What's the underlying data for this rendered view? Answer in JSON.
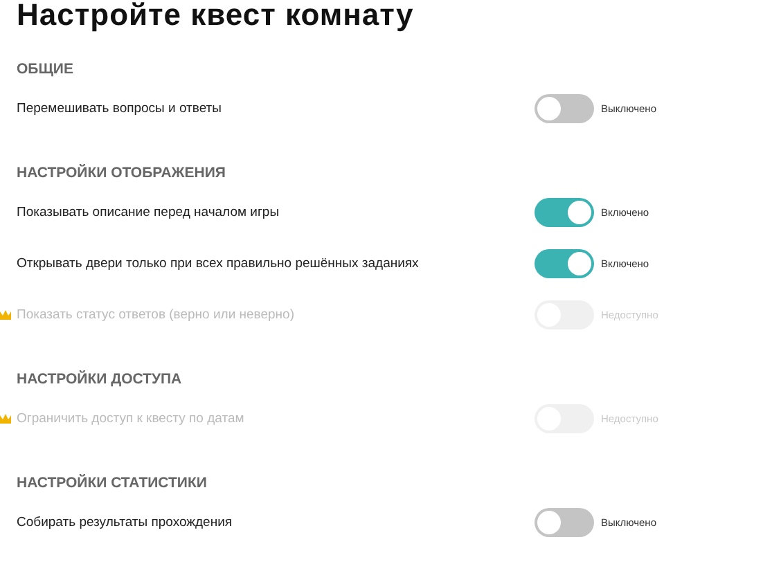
{
  "title": "Настройте квест комнату",
  "sections": [
    {
      "heading": "ОБЩИЕ",
      "settings": [
        {
          "label": "Перемешивать вопросы и ответы",
          "on": false,
          "disabled": false,
          "premium": false,
          "status": "Выключено"
        }
      ]
    },
    {
      "heading": "НАСТРОЙКИ ОТОБРАЖЕНИЯ",
      "settings": [
        {
          "label": "Показывать описание перед началом игры",
          "on": true,
          "disabled": false,
          "premium": false,
          "status": "Включено"
        },
        {
          "label": "Открывать двери только при всех правильно решённых заданиях",
          "on": true,
          "disabled": false,
          "premium": false,
          "status": "Включено"
        },
        {
          "label": "Показать статус ответов (верно или неверно)",
          "on": false,
          "disabled": true,
          "premium": true,
          "status": "Недоступно"
        }
      ]
    },
    {
      "heading": "НАСТРОЙКИ ДОСТУПА",
      "settings": [
        {
          "label": "Ограничить доступ к квесту по датам",
          "on": false,
          "disabled": true,
          "premium": true,
          "status": "Недоступно"
        }
      ]
    },
    {
      "heading": "НАСТРОЙКИ СТАТИСТИКИ",
      "settings": [
        {
          "label": "Собирать результаты прохождения",
          "on": false,
          "disabled": false,
          "premium": false,
          "status": "Выключено"
        }
      ]
    }
  ]
}
